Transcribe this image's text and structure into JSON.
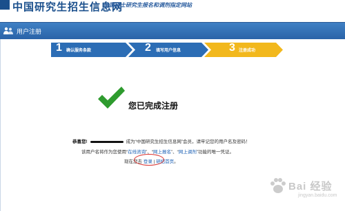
{
  "header": {
    "site_title": "中国研究生招生信息网",
    "site_subtitle": "全国硕士研究生报名和调剂指定网站"
  },
  "section": {
    "title": "用户注册"
  },
  "steps": [
    {
      "number": "1",
      "label": "确认服务条款",
      "state": "done"
    },
    {
      "number": "2",
      "label": "填写用户信息",
      "state": "done"
    },
    {
      "number": "3",
      "label": "注册成功",
      "state": "current"
    }
  ],
  "colors": {
    "step_done": "#2c6db5",
    "step_current": "#f2b81d",
    "brand": "#1a4f8c",
    "link": "#1a5fb4",
    "check": "#2e9b2e"
  },
  "success": {
    "icon": "check-icon",
    "title": "您已完成注册"
  },
  "message": {
    "line1_congrats": "恭喜您!",
    "line1_rest": "成为“中国研究生招生信息网”会员，请牢记您的用户名及密码！",
    "line2_prefix": "该用户名将作为您使用“",
    "link_consult": "在线咨询",
    "sep1": "”、“",
    "link_register": "网上报名",
    "sep2": "”、“",
    "link_adjust": "网上调剂",
    "line2_suffix": "”功能的唯一凭证。",
    "line3_prefix": "现在您去",
    "link_login": "登录",
    "line3_sep": "|",
    "link_home": "研招首页",
    "line3_suffix": "。"
  },
  "watermark": {
    "text": "Bai 经验",
    "sub": "jingyan.baidu.com"
  }
}
